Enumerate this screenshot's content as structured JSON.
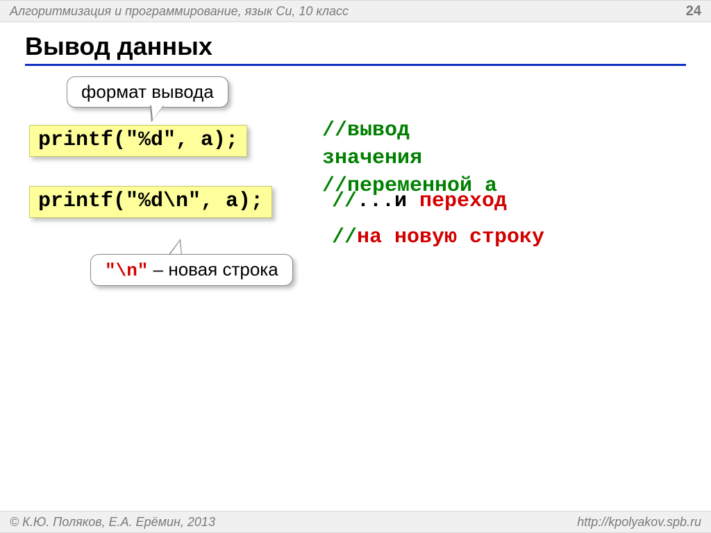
{
  "header": {
    "subject": "Алгоритмизация и программирование, язык Си, 10 класс",
    "page": "24"
  },
  "title": "Вывод данных",
  "callout_top": "формат вывода",
  "code1": "printf(\"%d\", a);",
  "code2": "printf(\"%d\\n\", a);",
  "comment1_l1": "//вывод",
  "comment1_l2": "значения",
  "comment1_l3": "//переменной a",
  "comment2_prefix": "//",
  "comment2_mid": "...и ",
  "comment2_word": "переход",
  "comment3_prefix": "//",
  "comment3_rest": "на новую строку",
  "callout_bottom_code": "\"\\n\"",
  "callout_bottom_dash": " – ",
  "callout_bottom_text": "новая строка",
  "footer": {
    "copyright": "© К.Ю. Поляков, Е.А. Ерёмин, 2013",
    "url": "http://kpolyakov.spb.ru"
  }
}
